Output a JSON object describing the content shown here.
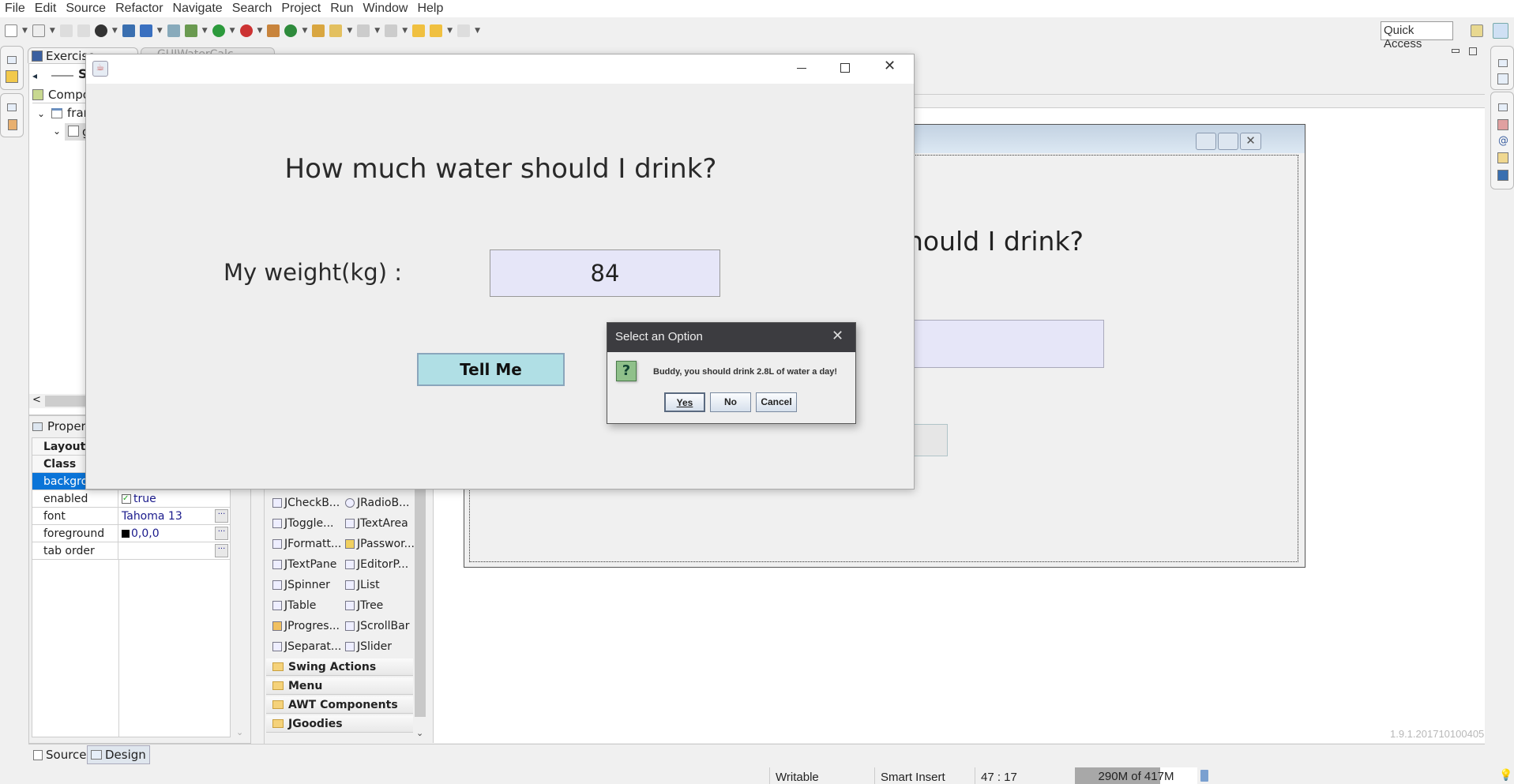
{
  "menu": [
    "File",
    "Edit",
    "Source",
    "Refactor",
    "Navigate",
    "Search",
    "Project",
    "Run",
    "Window",
    "Help"
  ],
  "toolbar": {
    "quick_access": "Quick Access"
  },
  "left_panel": {
    "tab_label": "Exercise",
    "editor_tab_label": "GUIWaterCalc",
    "structure_label": "S",
    "components_label": "Compo",
    "tree": [
      "fran",
      "g"
    ]
  },
  "properties": {
    "title": "Proper",
    "rows": [
      {
        "key": "Layout",
        "value": "",
        "bold": true
      },
      {
        "key": "Class",
        "value": "",
        "bold": true
      },
      {
        "key": "backgro",
        "value": "",
        "selected": true
      },
      {
        "key": "enabled",
        "value": "true",
        "checkbox": true
      },
      {
        "key": "font",
        "value": "Tahoma 13",
        "button": true
      },
      {
        "key": "foreground",
        "value": "0,0,0",
        "swatch": "#000000",
        "button": true
      },
      {
        "key": "tab order",
        "value": "",
        "button": true
      }
    ]
  },
  "palette": {
    "items": [
      "JCheckB...",
      "JRadioB...",
      "JToggle...",
      "JTextArea",
      "JFormatt...",
      "JPasswor...",
      "JTextPane",
      "JEditorP...",
      "JSpinner",
      "JList",
      "JTable",
      "JTree",
      "JProgres...",
      "JScrollBar",
      "JSeparat...",
      "JSlider"
    ],
    "categories": [
      "Swing Actions",
      "Menu",
      "AWT Components",
      "JGoodies"
    ]
  },
  "bottom_tabs": {
    "source": "Source",
    "design": "Design"
  },
  "designer": {
    "heading_partial": "hould I drink?",
    "version": "1.9.1.201710100405"
  },
  "app": {
    "heading": "How much water should I drink?",
    "weight_label": "My weight(kg) :",
    "weight_value": "84",
    "button": "Tell Me",
    "colors": {
      "input_bg": "#e6e6f8",
      "button_bg": "#b0dfe5"
    }
  },
  "dialog": {
    "title": "Select an Option",
    "message": "Buddy, you should drink 2.8L of water a day!",
    "icon": "?",
    "buttons": [
      "Yes",
      "No",
      "Cancel"
    ]
  },
  "status": {
    "writable": "Writable",
    "insert_mode": "Smart Insert",
    "position": "47 : 17",
    "memory": "290M of 417M",
    "memory_used_fraction": 0.695
  }
}
